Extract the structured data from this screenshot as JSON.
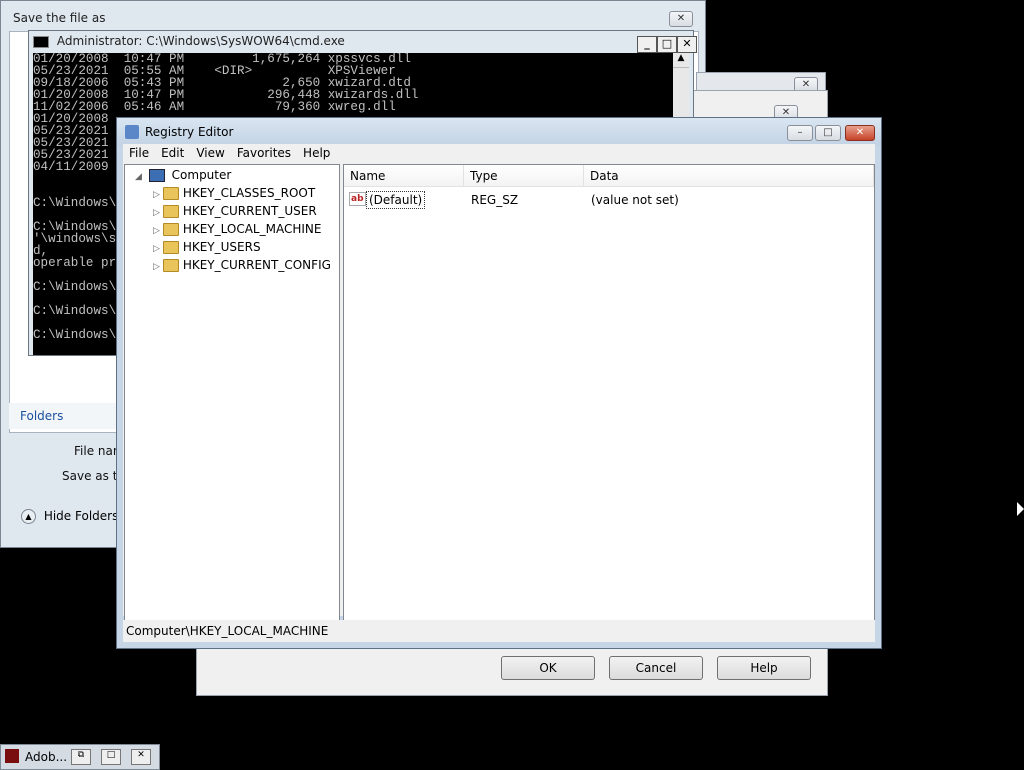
{
  "save_dialog": {
    "title": "Save the file as",
    "folders_label": "Folders",
    "file_name_label": "File nam",
    "save_as_type_label": "Save as typ",
    "hide_folders": "Hide Folders"
  },
  "cmd": {
    "title": "Administrator: C:\\Windows\\SysWOW64\\cmd.exe",
    "lines": [
      "01/20/2008  10:47 PM         1,675,264 xpssvcs.dll",
      "05/23/2021  05:55 AM    <DIR>          XPSViewer",
      "09/18/2006  05:43 PM             2,650 xwizard.dtd",
      "01/20/2008  10:47 PM           296,448 xwizards.dll",
      "11/02/2006  05:46 AM            79,360 xwreg.dll",
      "01/20/2008",
      "05/23/2021",
      "05/23/2021",
      "05/23/2021",
      "04/11/2009",
      "",
      "",
      "C:\\Windows\\",
      "",
      "C:\\Windows\\",
      "'\\windows\\s",
      "d,",
      "operable pr",
      "",
      "C:\\Windows\\",
      "",
      "C:\\Windows\\",
      "",
      "C:\\Windows\\"
    ]
  },
  "dialog_buttons": {
    "ok": "OK",
    "cancel": "Cancel",
    "help": "Help"
  },
  "registry": {
    "title": "Registry Editor",
    "menu": [
      "File",
      "Edit",
      "View",
      "Favorites",
      "Help"
    ],
    "tree_root": "Computer",
    "tree_items": [
      "HKEY_CLASSES_ROOT",
      "HKEY_CURRENT_USER",
      "HKEY_LOCAL_MACHINE",
      "HKEY_USERS",
      "HKEY_CURRENT_CONFIG"
    ],
    "columns": [
      "Name",
      "Type",
      "Data"
    ],
    "values": [
      {
        "name": "(Default)",
        "type": "REG_SZ",
        "data": "(value not set)"
      }
    ],
    "status": "Computer\\HKEY_LOCAL_MACHINE"
  },
  "taskbar": {
    "item_label": "Adob..."
  }
}
